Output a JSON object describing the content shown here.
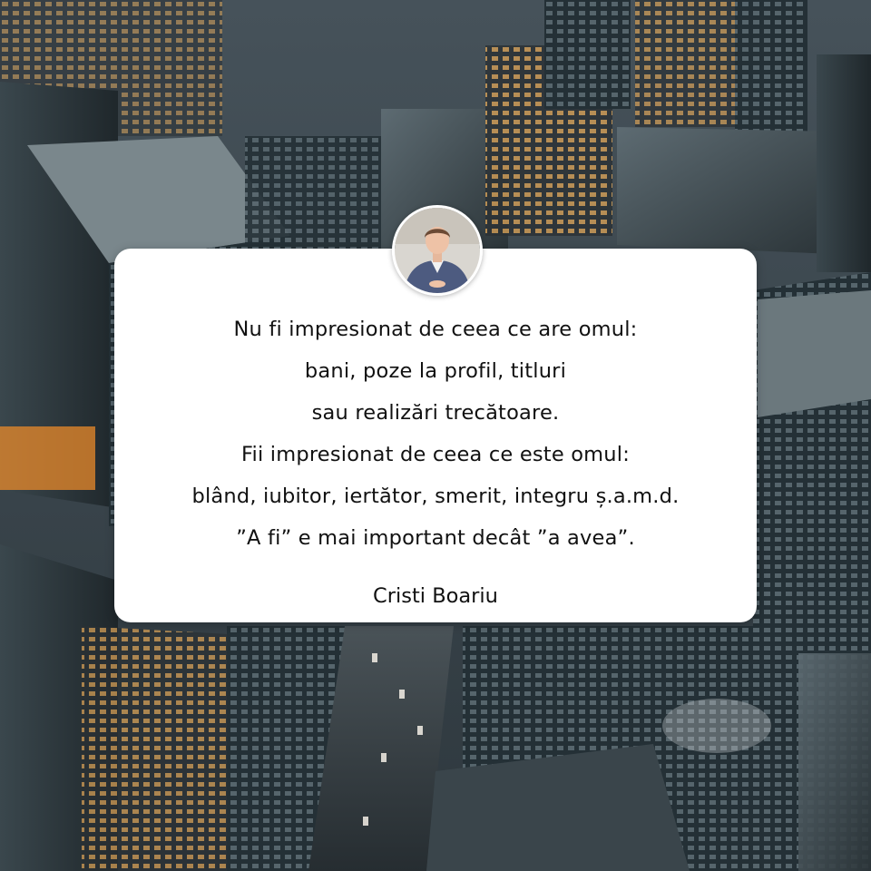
{
  "quote": {
    "lines": [
      "Nu fi impresionat de ceea ce are omul:",
      "bani, poze la profil, titluri",
      "sau realizări trecătoare.",
      "Fii impresionat de ceea ce este omul:",
      "blând, iubitor, iertător, smerit, integru ș.a.m.d.",
      "”A fi” e mai important decât ”a avea”."
    ],
    "author": "Cristi Boariu"
  },
  "colors": {
    "card_background": "#ffffff",
    "text": "#111111",
    "city_shadow": "#2b3438",
    "window_light": "#f2b25a"
  },
  "background": {
    "scene": "aerial-city-at-dusk"
  }
}
